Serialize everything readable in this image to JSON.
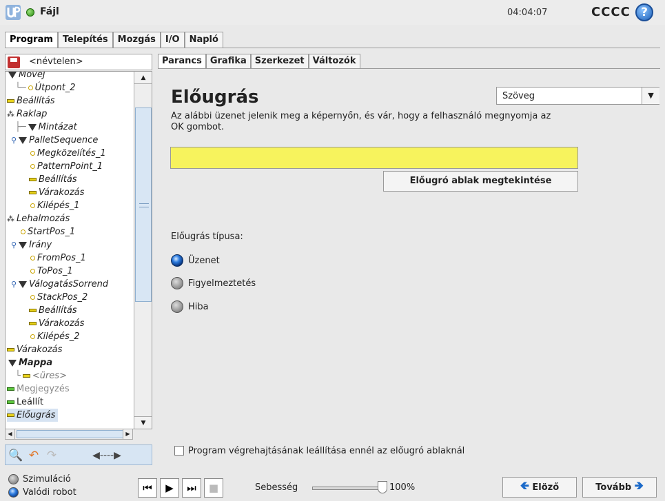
{
  "header": {
    "file_menu": "Fájl",
    "clock": "04:04:07",
    "robot_name": "CCCC",
    "help_icon": "?"
  },
  "main_tabs": [
    "Program",
    "Telepítés",
    "Mozgás",
    "I/O",
    "Napló"
  ],
  "left_panel": {
    "file_name": "<névtelen>",
    "tree": [
      {
        "label": "MoveJ",
        "icon": "triangle-icon"
      },
      {
        "label": "Útpont_2",
        "icon": "waypoint-icon"
      },
      {
        "label": "Beállítás",
        "icon": "set-icon"
      },
      {
        "label": "Raklap",
        "icon": "pallet-icon"
      },
      {
        "label": "Mintázat",
        "icon": "triangle-icon"
      },
      {
        "label": "PalletSequence",
        "icon": "triangle-icon"
      },
      {
        "label": "Megközelítés_1",
        "icon": "waypoint-icon"
      },
      {
        "label": "PatternPoint_1",
        "icon": "waypoint-icon"
      },
      {
        "label": "Beállítás",
        "icon": "set-icon"
      },
      {
        "label": "Várakozás",
        "icon": "wait-icon"
      },
      {
        "label": "Kilépés_1",
        "icon": "waypoint-icon"
      },
      {
        "label": "Lehalmozás",
        "icon": "pallet-icon"
      },
      {
        "label": "StartPos_1",
        "icon": "waypoint-icon"
      },
      {
        "label": "Irány",
        "icon": "triangle-icon"
      },
      {
        "label": "FromPos_1",
        "icon": "waypoint-icon"
      },
      {
        "label": "ToPos_1",
        "icon": "waypoint-icon"
      },
      {
        "label": "VálogatásSorrend",
        "icon": "triangle-icon"
      },
      {
        "label": "StackPos_2",
        "icon": "waypoint-icon"
      },
      {
        "label": "Beállítás",
        "icon": "set-icon"
      },
      {
        "label": "Várakozás",
        "icon": "wait-icon"
      },
      {
        "label": "Kilépés_2",
        "icon": "waypoint-icon"
      },
      {
        "label": "Várakozás",
        "icon": "wait-icon"
      },
      {
        "label": "Mappa",
        "icon": "triangle-icon"
      },
      {
        "label": "<üres>",
        "icon": "wait-icon"
      },
      {
        "label": "Megjegyzés",
        "icon": "comment-icon"
      },
      {
        "label": "Leállít",
        "icon": "stop-icon"
      },
      {
        "label": "Előugrás",
        "icon": "popup-icon"
      }
    ],
    "tools": {
      "search": "🔍",
      "undo": "↶",
      "redo": "↷",
      "move": "◀----▶"
    }
  },
  "sub_tabs": [
    "Parancs",
    "Grafika",
    "Szerkezet",
    "Változók"
  ],
  "command": {
    "title": "Előugrás",
    "description": "Az alábbi üzenet jelenik meg a képernyőn, és vár, hogy a felhasználó megnyomja az OK gombot.",
    "type_select_value": "Szöveg",
    "message_value": "",
    "preview_button": "Előugró ablak megtekintése",
    "popup_type_label": "Előugrás típusa:",
    "popup_types": [
      {
        "label": "Üzenet",
        "selected": true
      },
      {
        "label": "Figyelmeztetés",
        "selected": false
      },
      {
        "label": "Hiba",
        "selected": false
      }
    ],
    "stop_checkbox_label": "Program végrehajtásának leállítása ennél az előugró ablaknál",
    "stop_checkbox_checked": false
  },
  "bottom": {
    "simulation_label": "Szimuláció",
    "real_robot_label": "Valódi robot",
    "speed_label": "Sebesség",
    "speed_value": "100%",
    "speed_fraction": 1.0,
    "prev_button": "Elöző",
    "next_button": "Tovább"
  },
  "colors": {
    "message_field": "#f7f35d",
    "accent_blue": "#1b6ac9",
    "status_green": "#2c8f12"
  }
}
